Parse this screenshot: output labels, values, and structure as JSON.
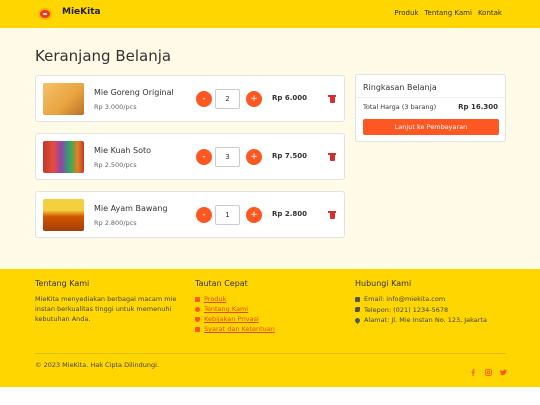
{
  "navbar": {
    "brand": "MieKita",
    "links": [
      "Produk",
      "Tentang Kami",
      "Kontak"
    ]
  },
  "page": {
    "title": "Keranjang Belanja"
  },
  "cart": {
    "items": [
      {
        "name": "Mie Goreng Original",
        "price": "Rp 3.000/pcs",
        "qty": "2",
        "total": "Rp 6.000",
        "thumb_color": "#e8a33d"
      },
      {
        "name": "Mie Kuah Soto",
        "price": "Rp 2.500/pcs",
        "qty": "3",
        "total": "Rp 7.500",
        "thumb_color": "#c0392b"
      },
      {
        "name": "Mie Ayam Bawang",
        "price": "Rp 2.800/pcs",
        "qty": "1",
        "total": "Rp 2.800",
        "thumb_color": "#d35400"
      }
    ],
    "minus_label": "-",
    "plus_label": "+"
  },
  "summary": {
    "title": "Ringkasan Belanja",
    "total_label": "Total Harga (3 barang)",
    "total_value": "Rp 16.300",
    "checkout_label": "Lanjut ke Pembayaran"
  },
  "footer": {
    "about_title": "Tentang Kami",
    "about_text": "MieKita menyediakan berbagai macam mie instan berkualitas tinggi untuk memenuhi kebutuhan Anda.",
    "links_title": "Tautan Cepat",
    "links": [
      "Produk",
      "Tentang Kami",
      "Kebijakan Privasi",
      "Syarat dan Ketentuan"
    ],
    "contact_title": "Hubungi Kami",
    "contact": [
      "Email: info@miekita.com",
      "Telepon: (021) 1234-5678",
      "Alamat: Jl. Mie Instan No. 123, Jakarta"
    ],
    "copyright": "© 2023 MieKita. Hak Cipta Dilindungi.",
    "social_icons": [
      "facebook-icon",
      "instagram-icon",
      "twitter-icon"
    ]
  },
  "colors": {
    "primary_yellow": "#ffd600",
    "accent_orange": "#ff5722",
    "background": "#fffbe6",
    "danger_red": "#d32f2f"
  }
}
